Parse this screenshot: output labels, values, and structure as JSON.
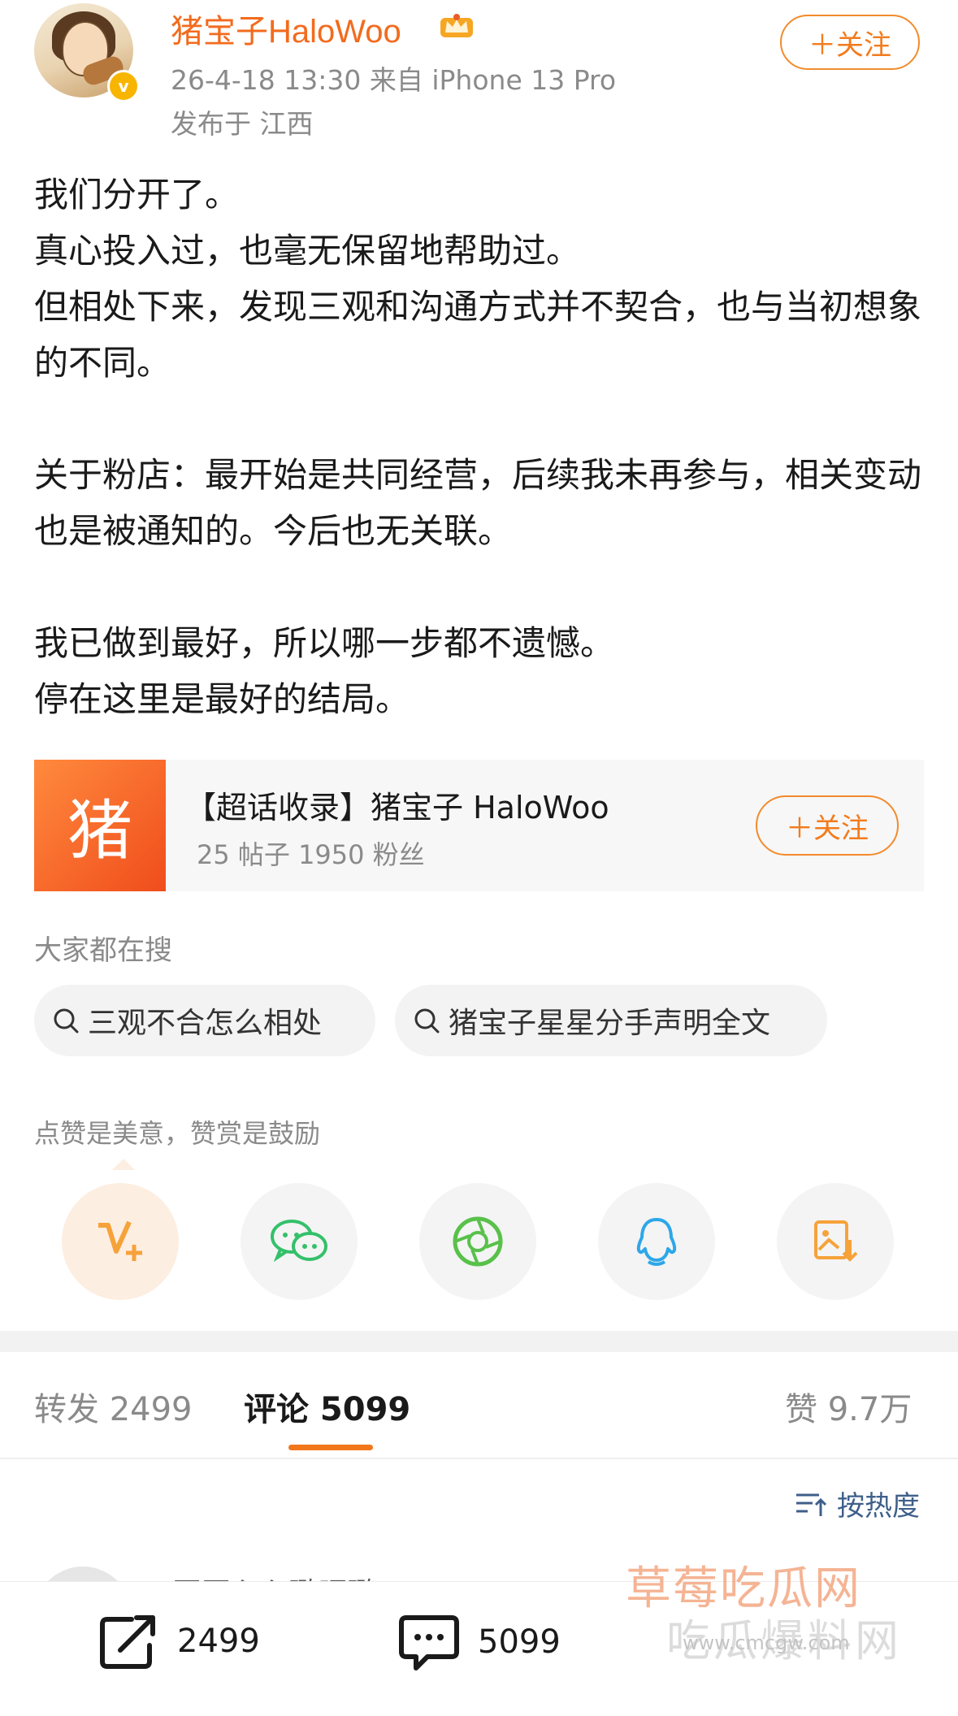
{
  "header": {
    "username": "猪宝子HaloWoo",
    "meta": "26-4-18 13:30  来自 iPhone 13 Pro",
    "location": "发布于 江西",
    "follow_label": "＋关注",
    "verified_mark": "v"
  },
  "post": {
    "paragraphs": [
      "我们分开了。",
      "真心投入过，也毫无保留地帮助过。",
      "但相处下来，发现三观和沟通方式并不契合，也与当初想象的不同。",
      "",
      "关于粉店：最开始是共同经营，后续我未再参与，相关变动也是被通知的。今后也无关联。",
      "",
      "我已做到最好，所以哪一步都不遗憾。",
      "停在这里是最好的结局。"
    ]
  },
  "super_topic": {
    "logo_char": "猪",
    "title": "【超话收录】猪宝子 HaloWoo",
    "subtitle": "25 帖子 1950 粉丝",
    "follow_label": "＋关注"
  },
  "search": {
    "heading": "大家都在搜",
    "chips": [
      "三观不合怎么相处",
      "猪宝子星星分手声明全文"
    ]
  },
  "reward": {
    "text": "点赞是美意，赞赏是鼓励"
  },
  "share_icons": [
    "reward-icon",
    "wechat-icon",
    "moments-icon",
    "qq-icon",
    "save-image-icon"
  ],
  "tabs": {
    "repost": "转发 2499",
    "comments": "评论 5099",
    "likes": "赞 9.7万"
  },
  "sort_label": "按热度",
  "comment_preview": {
    "name": "开开心心璐嘿璐"
  },
  "bottom_bar": {
    "repost_count": "2499",
    "comment_count": "5099"
  },
  "watermark": {
    "line1": "草莓吃瓜网",
    "line2": "吃瓜爆料网",
    "line3": "www.cmcgw.com"
  },
  "colors": {
    "accent": "#f27b1d",
    "link": "#3f5f8a",
    "secondary_text": "#8a8a8a"
  }
}
